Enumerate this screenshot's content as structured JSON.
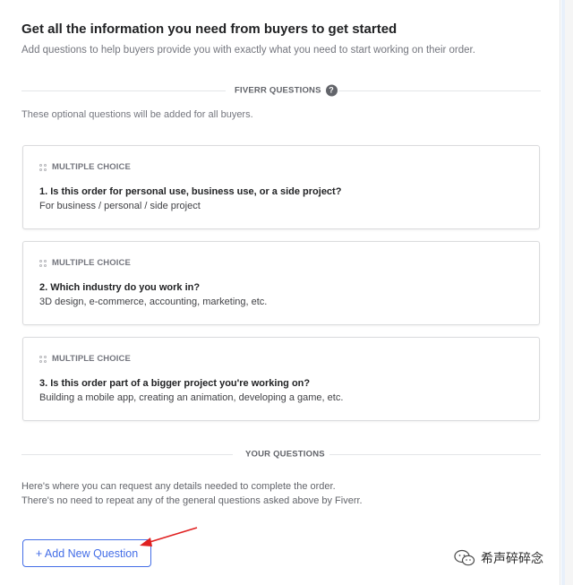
{
  "header": {
    "title": "Get all the information you need from buyers to get started",
    "subtitle": "Add questions to help buyers provide you with exactly what you need to start working on their order."
  },
  "fiverr_section": {
    "label": "FIVERR QUESTIONS",
    "help_icon": "?",
    "note": "These optional questions will be added for all buyers."
  },
  "questions": [
    {
      "type": "MULTIPLE CHOICE",
      "question": "1. Is this order for personal use, business use, or a side project?",
      "hint": "For business / personal / side project"
    },
    {
      "type": "MULTIPLE CHOICE",
      "question": "2. Which industry do you work in?",
      "hint": "3D design, e-commerce, accounting, marketing, etc."
    },
    {
      "type": "MULTIPLE CHOICE",
      "question": "3. Is this order part of a bigger project you're working on?",
      "hint": "Building a mobile app, creating an animation, developing a game, etc."
    }
  ],
  "your_section": {
    "label": "YOUR QUESTIONS",
    "line1": "Here's where you can request any details needed to complete the order.",
    "line2": "There's no need to repeat any of the general questions asked above by Fiverr."
  },
  "add_button": {
    "label": "+ Add New Question"
  },
  "watermark": {
    "text": "希声碎碎念",
    "icon": "wechat-icon"
  },
  "colors": {
    "accent": "#446ee7",
    "annotation_arrow": "#e02020"
  }
}
